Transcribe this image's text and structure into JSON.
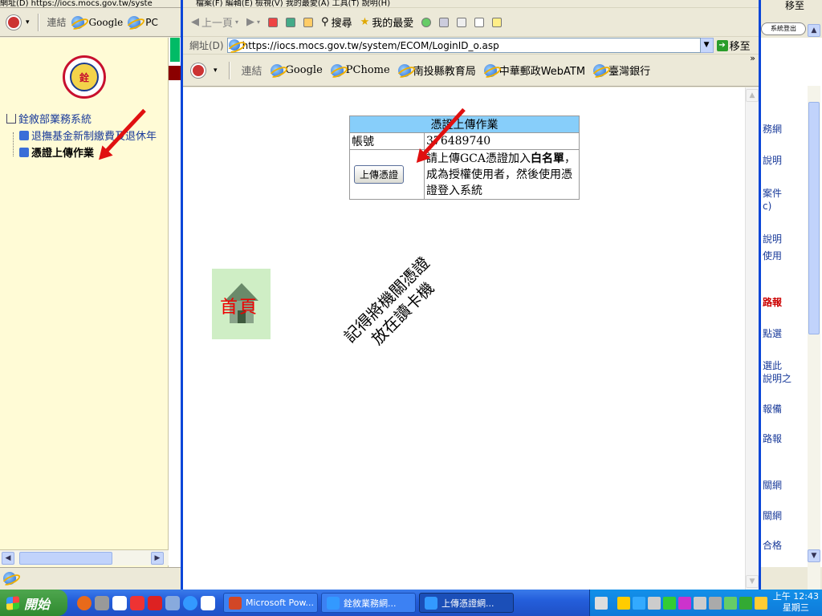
{
  "bg_left": {
    "menubar_text": "網址(D) https://iocs.mocs.gov.tw/syste",
    "toolbar_links": [
      "連結",
      "Google",
      "PC"
    ],
    "tree_root": "銓敘部業務系統",
    "tree_items": [
      "退撫基金新制繳費及退休年",
      "憑證上傳作業"
    ]
  },
  "bg_right": {
    "items": [
      "務網",
      "說明",
      "案件",
      "c)",
      "說明",
      "使用",
      "路報",
      "點選",
      "選此",
      "說明之",
      "報備",
      "路報",
      "關網",
      "關網",
      "合格"
    ],
    "top_label": "移至",
    "logout_label": "系統登出"
  },
  "browser": {
    "menu_text": "檔案(F)  編輯(E)  檢視(V)  我的最愛(A)  工具(T)  說明(H)",
    "toolbar": {
      "back_label": "上一頁",
      "search_label": "搜尋",
      "favorites_label": "我的最愛"
    },
    "address": {
      "label": "網址(D)",
      "url": "https://iocs.mocs.gov.tw/system/ECOM/LoginID_o.asp",
      "go_label": "移至"
    },
    "links": {
      "label": "連結",
      "items": [
        "Google",
        "PChome",
        "南投縣教育局",
        "中華郵政WebATM",
        "臺灣銀行"
      ]
    }
  },
  "page": {
    "table_title": "憑證上傳作業",
    "account_label": "帳號",
    "account_value": "376489740",
    "upload_button": "上傳憑證",
    "instruction_part1": "請上傳GCA憑證加入",
    "instruction_bold": "白名單",
    "instruction_part2": "，成為授權使用者，然後使用憑證登入系統",
    "home_label": "首頁",
    "note_line1": "記得將機關憑證",
    "note_line2": "放在讀卡機"
  },
  "taskbar": {
    "start_label": "開始",
    "tasks": [
      "Microsoft Pow...",
      "銓敘業務網...",
      "上傳憑證網..."
    ],
    "clock_time": "上午 12:43",
    "clock_day": "星期三"
  }
}
